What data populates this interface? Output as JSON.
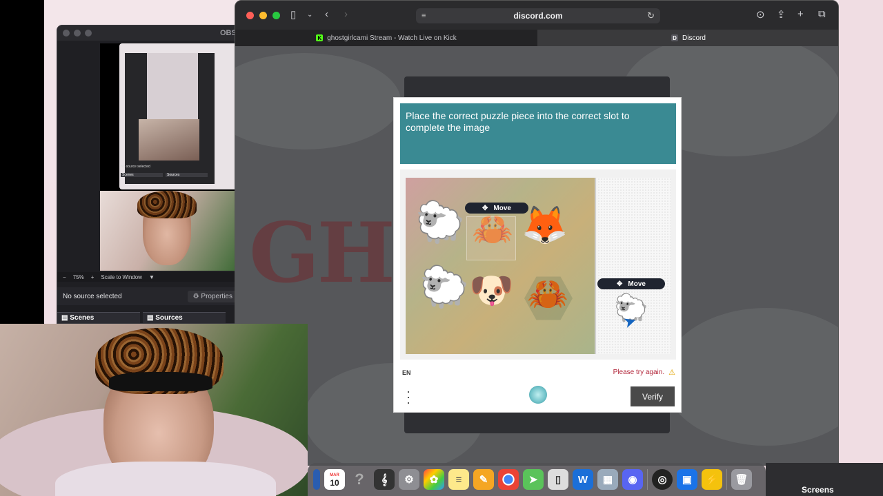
{
  "obs": {
    "title": "OBS",
    "zoom_value": "75%",
    "scale_label": "Scale to Window",
    "no_source": "No source selected",
    "properties_label": "Properties",
    "scenes_label": "Scenes",
    "sources_label": "Sources",
    "nested_status": "No source selected",
    "nested_properties": "Properties",
    "nested_scenes": "Scenes",
    "nested_sources": "Sources"
  },
  "safari": {
    "address": "discord.com",
    "tabs": [
      {
        "label": "ghostgirlcami Stream - Watch Live on Kick",
        "favicon": "K"
      },
      {
        "label": "Discord",
        "favicon": "D"
      }
    ]
  },
  "page": {
    "bg_text": "GHO"
  },
  "captcha": {
    "prompt": "Place the correct puzzle piece into the correct slot to complete the image",
    "move_label": "Move",
    "move_label_2": "Move",
    "language": "EN",
    "error": "Please try again.",
    "verify_label": "Verify",
    "animals": [
      "sheep",
      "crab",
      "red-panda",
      "sheep",
      "french-bulldog",
      "crab"
    ]
  },
  "dock": {
    "calendar_month": "MAR",
    "calendar_day": "10",
    "icons": [
      "finder",
      "calendar",
      "help",
      "guitar",
      "settings",
      "photos",
      "notes",
      "pages",
      "chrome",
      "maps",
      "phone",
      "webex",
      "preview",
      "discord",
      "obs",
      "roblox",
      "studio",
      "trash"
    ]
  },
  "overlay": {
    "screenshot_label": "Screens"
  },
  "colors": {
    "prompt_bg": "#3a8a93",
    "error_red": "#b2263a",
    "verify_bg": "#4a4a4a"
  }
}
